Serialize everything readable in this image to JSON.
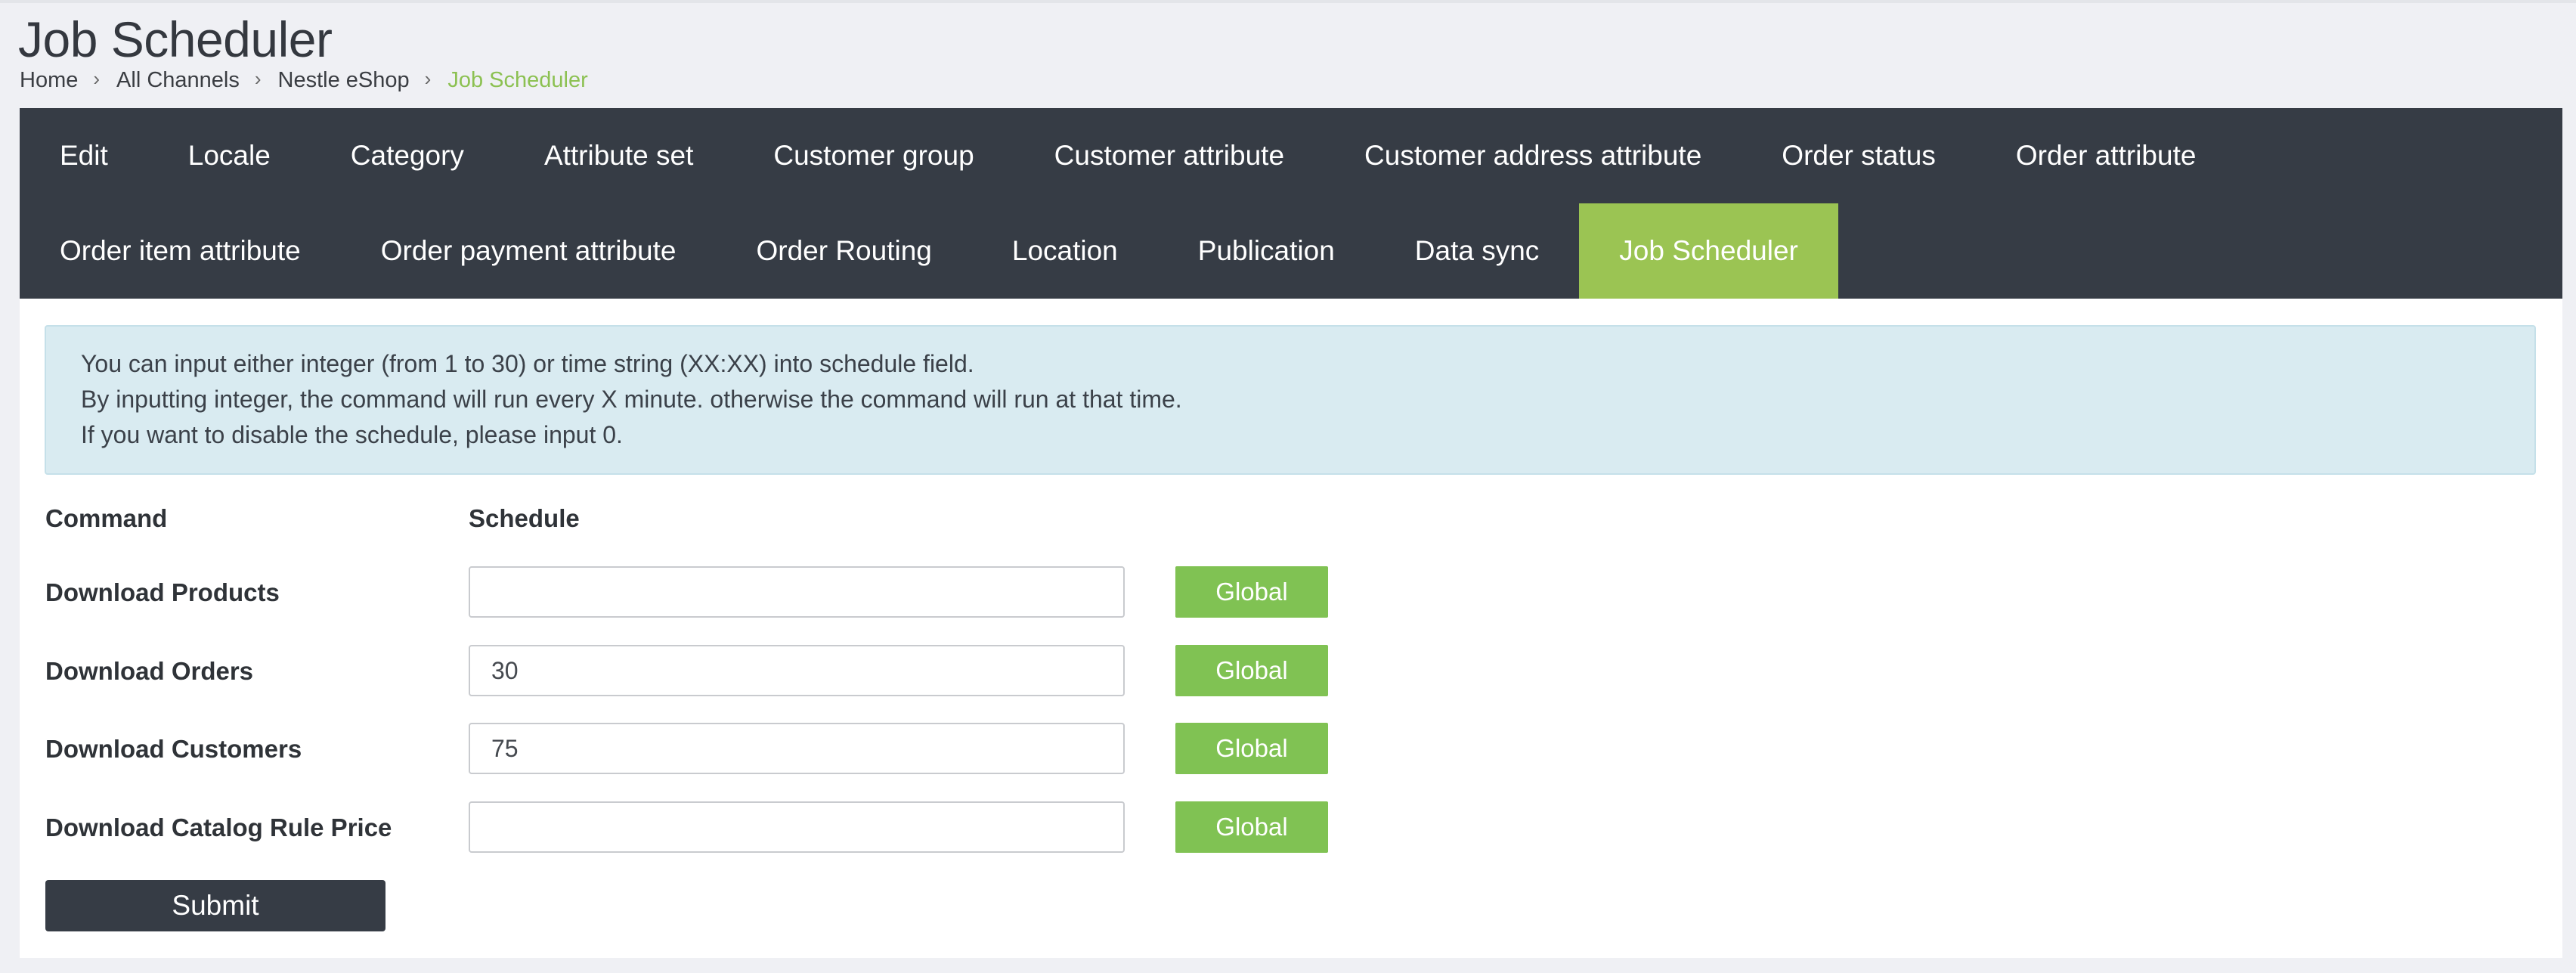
{
  "page": {
    "title": "Job Scheduler"
  },
  "breadcrumb": {
    "items": [
      "Home",
      "All Channels",
      "Nestle eShop",
      "Job Scheduler"
    ],
    "separator": "›"
  },
  "tabs": {
    "row1": [
      "Edit",
      "Locale",
      "Category",
      "Attribute set",
      "Customer group",
      "Customer attribute",
      "Customer address attribute",
      "Order status",
      "Order attribute"
    ],
    "row2": [
      "Order item attribute",
      "Order payment attribute",
      "Order Routing",
      "Location",
      "Publication",
      "Data sync",
      "Job Scheduler"
    ],
    "active": "Job Scheduler"
  },
  "info": {
    "lines": [
      "You can input either integer (from 1 to 30) or time string (XX:XX) into schedule field.",
      "By inputting integer, the command will run every X minute. otherwise the command will run at that time.",
      "If you want to disable the schedule, please input 0."
    ]
  },
  "table": {
    "headers": {
      "command": "Command",
      "schedule": "Schedule"
    },
    "rows": [
      {
        "command": "Download Products",
        "schedule": "",
        "button": "Global"
      },
      {
        "command": "Download Orders",
        "schedule": "30",
        "button": "Global"
      },
      {
        "command": "Download Customers",
        "schedule": "75",
        "button": "Global"
      },
      {
        "command": "Download Catalog Rule Price",
        "schedule": "",
        "button": "Global"
      }
    ]
  },
  "form": {
    "submit_label": "Submit"
  },
  "colors": {
    "nav_bg": "#363c45",
    "active_tab": "#9bc453",
    "global_button": "#80c253",
    "breadcrumb_active": "#8cc152",
    "info_bg": "#d9ebf1",
    "page_bg": "#eff0f4"
  }
}
